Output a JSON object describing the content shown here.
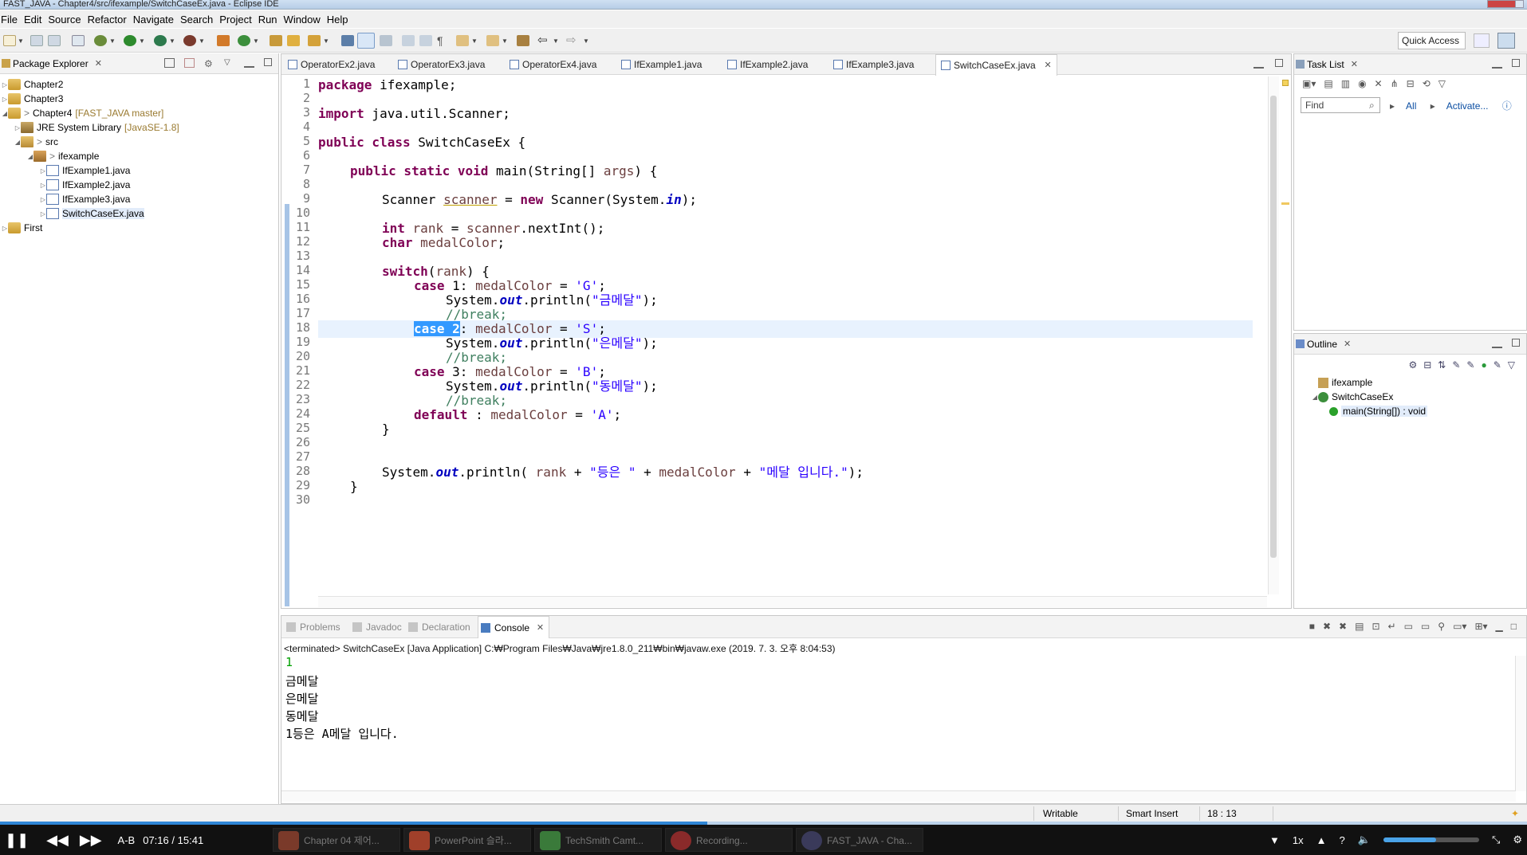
{
  "window": {
    "title": "FAST_JAVA - Chapter4/src/ifexample/SwitchCaseEx.java - Eclipse IDE"
  },
  "menu": [
    "File",
    "Edit",
    "Source",
    "Refactor",
    "Navigate",
    "Search",
    "Project",
    "Run",
    "Window",
    "Help"
  ],
  "toolbar": {
    "quick_access": "Quick Access"
  },
  "package_explorer": {
    "title": "Package Explorer",
    "nodes": [
      {
        "label": "Chapter2"
      },
      {
        "label": "Chapter3"
      },
      {
        "label": "Chapter4",
        "decoration": "[FAST_JAVA master]"
      },
      {
        "label": "JRE System Library",
        "decoration": "[JavaSE-1.8]"
      },
      {
        "label": "src"
      },
      {
        "label": "ifexample"
      },
      {
        "label": "IfExample1.java"
      },
      {
        "label": "IfExample2.java"
      },
      {
        "label": "IfExample3.java"
      },
      {
        "label": "SwitchCaseEx.java"
      },
      {
        "label": "First"
      }
    ]
  },
  "editor": {
    "tabs": [
      "OperatorEx2.java",
      "OperatorEx3.java",
      "OperatorEx4.java",
      "IfExample1.java",
      "IfExample2.java",
      "IfExample3.java",
      "SwitchCaseEx.java"
    ],
    "active_tab": "SwitchCaseEx.java",
    "line_numbers": [
      "1",
      "2",
      "3",
      "4",
      "5",
      "6",
      "7",
      "8",
      "9",
      "10",
      "11",
      "12",
      "13",
      "14",
      "15",
      "16",
      "17",
      "18",
      "19",
      "20",
      "21",
      "22",
      "23",
      "24",
      "25",
      "26",
      "27",
      "28",
      "29",
      "30"
    ],
    "code": {
      "l1_kw": "package",
      "l1_rest": " ifexample;",
      "l3_kw": "import",
      "l3_rest": " java.util.Scanner;",
      "l5_kw": "public class",
      "l5_rest": " SwitchCaseEx {",
      "l7_kw": "public static void",
      "l7_a": " main(String[] ",
      "l7_var": "args",
      "l7_b": ") {",
      "l9_a": "Scanner ",
      "l9_var": "scanner",
      "l9_b": " = ",
      "l9_kw": "new",
      "l9_c": " Scanner(System.",
      "l9_fld": "in",
      "l9_d": ");",
      "l11_kw": "int",
      "l11_a": " ",
      "l11_var": "rank",
      "l11_b": " = ",
      "l11_var2": "scanner",
      "l11_c": ".nextInt();",
      "l12_kw": "char",
      "l12_a": " ",
      "l12_var": "medalColor",
      "l12_b": ";",
      "l14_kw": "switch",
      "l14_a": "(",
      "l14_var": "rank",
      "l14_b": ") {",
      "l15_kw": "case",
      "l15_a": " 1: ",
      "l15_var": "medalColor",
      "l15_b": " = ",
      "l15_str": "'G'",
      "l15_c": ";",
      "l16_a": "System.",
      "l16_fld": "out",
      "l16_b": ".println(",
      "l16_str": "\"금메달\"",
      "l16_c": ");",
      "l17_cmt": "//break;",
      "l18_sel": "case 2",
      "l18_a": ": ",
      "l18_var": "medalColor",
      "l18_b": " = ",
      "l18_str": "'S'",
      "l18_c": ";",
      "l19_a": "System.",
      "l19_fld": "out",
      "l19_b": ".println(",
      "l19_str": "\"은메달\"",
      "l19_c": ");",
      "l20_cmt": "//break;",
      "l21_kw": "case",
      "l21_a": " 3: ",
      "l21_var": "medalColor",
      "l21_b": " = ",
      "l21_str": "'B'",
      "l21_c": ";",
      "l22_a": "System.",
      "l22_fld": "out",
      "l22_b": ".println(",
      "l22_str": "\"동메달\"",
      "l22_c": ");",
      "l23_cmt": "//break;",
      "l24_kw": "default",
      "l24_a": " : ",
      "l24_var": "medalColor",
      "l24_b": " = ",
      "l24_str": "'A'",
      "l24_c": ";",
      "l25": "}",
      "l28_a": "System.",
      "l28_fld": "out",
      "l28_b": ".println( ",
      "l28_var": "rank",
      "l28_c": " + ",
      "l28_str": "\"등은 \"",
      "l28_d": " + ",
      "l28_var2": "medalColor",
      "l28_e": " + ",
      "l28_str2": "\"메달 입니다.\"",
      "l28_f": ");",
      "l29": "}"
    }
  },
  "task_list": {
    "title": "Task List",
    "find_placeholder": "Find",
    "all": "All",
    "activate": "Activate..."
  },
  "outline": {
    "title": "Outline",
    "items": [
      "ifexample",
      "SwitchCaseEx",
      "main(String[]) : void"
    ]
  },
  "console": {
    "tabs": [
      "Problems",
      "Javadoc",
      "Declaration",
      "Console"
    ],
    "active": "Console",
    "description": "<terminated> SwitchCaseEx [Java Application] C:₩Program Files₩Java₩jre1.8.0_211₩bin₩javaw.exe (2019. 7. 3. 오후 8:04:53)",
    "output": [
      "1",
      "금메달",
      "은메달",
      "동메달",
      "1등은 A메달 입니다."
    ]
  },
  "status_bar": {
    "writable": "Writable",
    "insert_mode": "Smart Insert",
    "position": "18 : 13"
  },
  "video_player": {
    "ab": "A-B",
    "current_time": "07:16",
    "separator": "/",
    "total_time": "15:41",
    "progress": 0.463,
    "speed": "1x",
    "volume": 0.55
  },
  "taskbar": {
    "items": [
      "Chapter 04 제어...",
      "PowerPoint 슬라...",
      "TechSmith Camt...",
      "Recording...",
      "FAST_JAVA - Cha..."
    ]
  },
  "colors": {
    "keyword": "#7f0055",
    "string": "#2a00ff",
    "comment": "#3f7f5f",
    "field": "#0000c0",
    "variable": "#6a3e3e",
    "selection": "#3399ff",
    "line_highlight": "#e8f2fe",
    "link": "#0b4ea2"
  }
}
